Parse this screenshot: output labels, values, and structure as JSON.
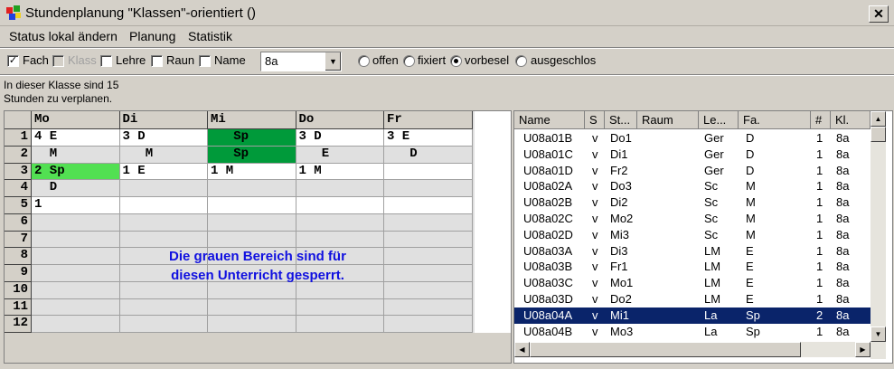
{
  "window": {
    "title": "Stundenplanung \"Klassen\"-orientiert ()",
    "close": "✕"
  },
  "menu": [
    "Status lokal ändern",
    "Planung",
    "Statistik"
  ],
  "toolbar": {
    "checkboxes": [
      {
        "label": "Fach",
        "checked": true,
        "enabled": true
      },
      {
        "label": "Klass",
        "checked": false,
        "enabled": false
      },
      {
        "label": "Lehre",
        "checked": false,
        "enabled": true
      },
      {
        "label": "Raun",
        "checked": false,
        "enabled": true
      },
      {
        "label": "Name",
        "checked": false,
        "enabled": true
      }
    ],
    "class_select": "8a",
    "dropdown_arrow": "▼",
    "check_mark": "✓",
    "radios": [
      {
        "label": "offen",
        "checked": false
      },
      {
        "label": "fixiert",
        "checked": false
      },
      {
        "label": "vorbesel",
        "checked": true
      },
      {
        "label": "ausgeschlos",
        "checked": false
      }
    ]
  },
  "info_line1": "In dieser Klasse sind 15",
  "info_line2": "Stunden zu verplanen.",
  "grid": {
    "days": [
      "Mo",
      "Di",
      "Mi",
      "Do",
      "Fr"
    ],
    "periods": [
      "1",
      "2",
      "3",
      "4",
      "5",
      "6",
      "7",
      "8",
      "9",
      "10",
      "11",
      "12"
    ],
    "cells": [
      [
        {
          "t": "4 E",
          "c": "white"
        },
        {
          "t": "3 D",
          "c": "white"
        },
        {
          "t": "   Sp",
          "c": "green"
        },
        {
          "t": "3 D",
          "c": "white"
        },
        {
          "t": "3 E",
          "c": "white"
        }
      ],
      [
        {
          "t": "  M",
          "c": "grey"
        },
        {
          "t": "   M",
          "c": "grey"
        },
        {
          "t": "   Sp",
          "c": "green"
        },
        {
          "t": "   E",
          "c": "grey"
        },
        {
          "t": "   D",
          "c": "grey"
        }
      ],
      [
        {
          "t": "2 Sp",
          "c": "lightgreen"
        },
        {
          "t": "1 E",
          "c": "white"
        },
        {
          "t": "1 M",
          "c": "white"
        },
        {
          "t": "1 M",
          "c": "white"
        },
        {
          "t": "",
          "c": "white"
        }
      ],
      [
        {
          "t": "  D",
          "c": "grey"
        },
        {
          "t": "",
          "c": "grey"
        },
        {
          "t": "",
          "c": "grey"
        },
        {
          "t": "",
          "c": "grey"
        },
        {
          "t": "",
          "c": "grey"
        }
      ],
      [
        {
          "t": "1",
          "c": "white"
        },
        {
          "t": "",
          "c": "white"
        },
        {
          "t": "",
          "c": "white"
        },
        {
          "t": "",
          "c": "white"
        },
        {
          "t": "",
          "c": "white"
        }
      ],
      [
        {
          "t": "",
          "c": "grey"
        },
        {
          "t": "",
          "c": "grey"
        },
        {
          "t": "",
          "c": "grey"
        },
        {
          "t": "",
          "c": "grey"
        },
        {
          "t": "",
          "c": "grey"
        }
      ],
      [
        {
          "t": "",
          "c": "grey"
        },
        {
          "t": "",
          "c": "grey"
        },
        {
          "t": "",
          "c": "grey"
        },
        {
          "t": "",
          "c": "grey"
        },
        {
          "t": "",
          "c": "grey"
        }
      ],
      [
        {
          "t": "",
          "c": "grey"
        },
        {
          "t": "",
          "c": "grey"
        },
        {
          "t": "",
          "c": "grey"
        },
        {
          "t": "",
          "c": "grey"
        },
        {
          "t": "",
          "c": "grey"
        }
      ],
      [
        {
          "t": "",
          "c": "grey"
        },
        {
          "t": "",
          "c": "grey"
        },
        {
          "t": "",
          "c": "grey"
        },
        {
          "t": "",
          "c": "grey"
        },
        {
          "t": "",
          "c": "grey"
        }
      ],
      [
        {
          "t": "",
          "c": "grey"
        },
        {
          "t": "",
          "c": "grey"
        },
        {
          "t": "",
          "c": "grey"
        },
        {
          "t": "",
          "c": "grey"
        },
        {
          "t": "",
          "c": "grey"
        }
      ],
      [
        {
          "t": "",
          "c": "grey"
        },
        {
          "t": "",
          "c": "grey"
        },
        {
          "t": "",
          "c": "grey"
        },
        {
          "t": "",
          "c": "grey"
        },
        {
          "t": "",
          "c": "grey"
        }
      ],
      [
        {
          "t": "",
          "c": "grey"
        },
        {
          "t": "",
          "c": "grey"
        },
        {
          "t": "",
          "c": "grey"
        },
        {
          "t": "",
          "c": "grey"
        },
        {
          "t": "",
          "c": "grey"
        }
      ]
    ],
    "annotation_line1": "Die grauen Bereich sind für",
    "annotation_line2": "diesen Unterricht gesperrt."
  },
  "list": {
    "columns": [
      "Name",
      "S",
      "St...",
      "Raum",
      "Le...",
      "Fa.",
      "#",
      "Kl."
    ],
    "rows": [
      [
        "U08a01B",
        "v",
        "Do1",
        "",
        "Ger",
        "D",
        "1",
        "8a"
      ],
      [
        "U08a01C",
        "v",
        "Di1",
        "",
        "Ger",
        "D",
        "1",
        "8a"
      ],
      [
        "U08a01D",
        "v",
        "Fr2",
        "",
        "Ger",
        "D",
        "1",
        "8a"
      ],
      [
        "U08a02A",
        "v",
        "Do3",
        "",
        "Sc",
        "M",
        "1",
        "8a"
      ],
      [
        "U08a02B",
        "v",
        "Di2",
        "",
        "Sc",
        "M",
        "1",
        "8a"
      ],
      [
        "U08a02C",
        "v",
        "Mo2",
        "",
        "Sc",
        "M",
        "1",
        "8a"
      ],
      [
        "U08a02D",
        "v",
        "Mi3",
        "",
        "Sc",
        "M",
        "1",
        "8a"
      ],
      [
        "U08a03A",
        "v",
        "Di3",
        "",
        "LM",
        "E",
        "1",
        "8a"
      ],
      [
        "U08a03B",
        "v",
        "Fr1",
        "",
        "LM",
        "E",
        "1",
        "8a"
      ],
      [
        "U08a03C",
        "v",
        "Mo1",
        "",
        "LM",
        "E",
        "1",
        "8a"
      ],
      [
        "U08a03D",
        "v",
        "Do2",
        "",
        "LM",
        "E",
        "1",
        "8a"
      ],
      [
        "U08a04A",
        "v",
        "Mi1",
        "",
        "La",
        "Sp",
        "2",
        "8a"
      ],
      [
        "U08a04B",
        "v",
        "Mo3",
        "",
        "La",
        "Sp",
        "1",
        "8a"
      ]
    ],
    "selected_row": 11,
    "scroll_up": "▲",
    "scroll_down": "▼",
    "scroll_left": "◀",
    "scroll_right": "▶"
  },
  "colors": {
    "locked": "#e0e0e0",
    "fixed": "#009a3a",
    "preset": "#52e052",
    "selection": "#0a246a",
    "annotation": "#1010e0"
  }
}
